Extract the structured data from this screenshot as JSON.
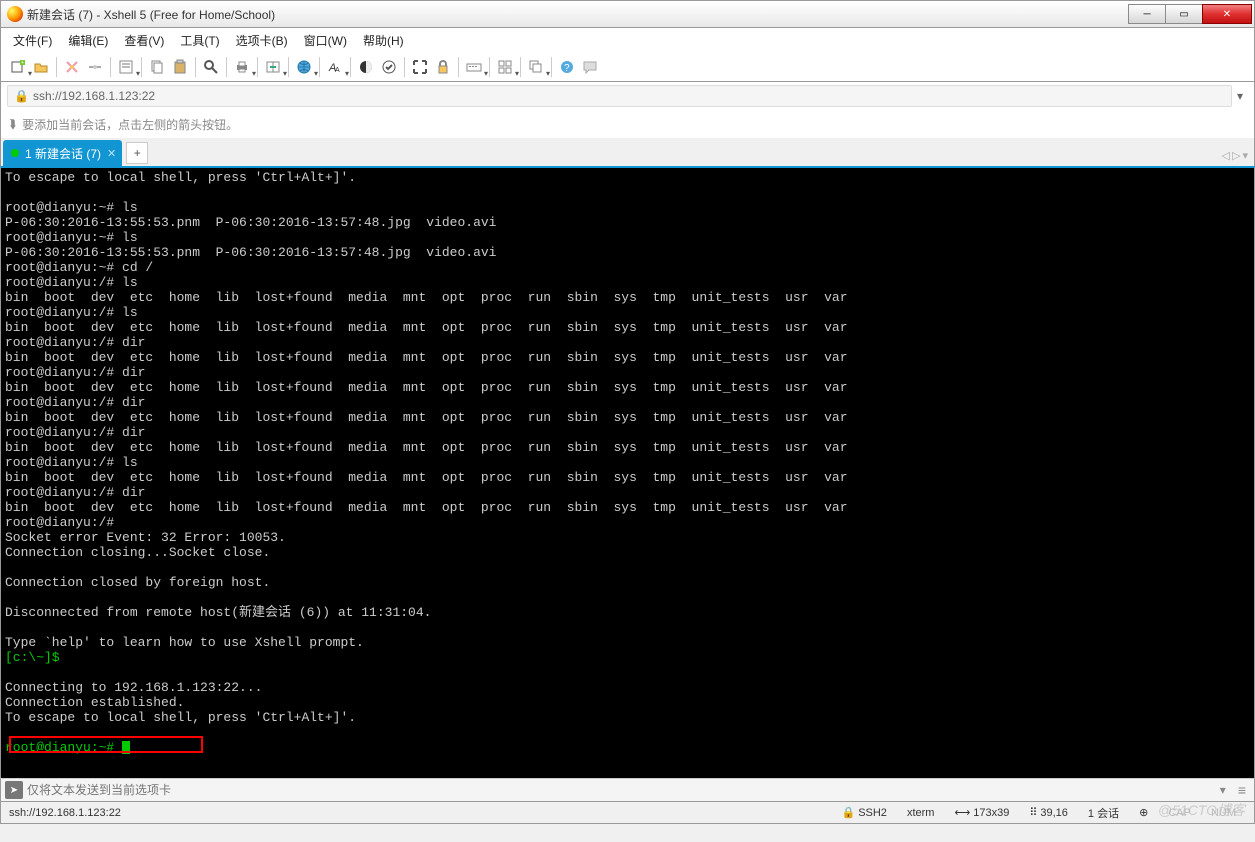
{
  "window": {
    "title": "新建会话 (7) - Xshell 5 (Free for Home/School)"
  },
  "menu": {
    "file": "文件(F)",
    "edit": "编辑(E)",
    "view": "查看(V)",
    "tools": "工具(T)",
    "tabs": "选项卡(B)",
    "window": "窗口(W)",
    "help": "帮助(H)"
  },
  "address": {
    "url": "ssh://192.168.1.123:22"
  },
  "hint": {
    "text": "要添加当前会话，点击左侧的箭头按钮。"
  },
  "tab": {
    "label": "1 新建会话 (7)",
    "add": "+"
  },
  "terminal": {
    "lines": [
      {
        "t": "To escape to local shell, press 'Ctrl+Alt+]'.",
        "c": ""
      },
      {
        "t": "",
        "c": ""
      },
      {
        "t": "root@dianyu:~# ls",
        "c": ""
      },
      {
        "t": "P-06:30:2016-13:55:53.pnm  P-06:30:2016-13:57:48.jpg  video.avi",
        "c": ""
      },
      {
        "t": "root@dianyu:~# ls",
        "c": ""
      },
      {
        "t": "P-06:30:2016-13:55:53.pnm  P-06:30:2016-13:57:48.jpg  video.avi",
        "c": ""
      },
      {
        "t": "root@dianyu:~# cd /",
        "c": ""
      },
      {
        "t": "root@dianyu:/# ls",
        "c": ""
      },
      {
        "t": "bin  boot  dev  etc  home  lib  lost+found  media  mnt  opt  proc  run  sbin  sys  tmp  unit_tests  usr  var",
        "c": ""
      },
      {
        "t": "root@dianyu:/# ls",
        "c": ""
      },
      {
        "t": "bin  boot  dev  etc  home  lib  lost+found  media  mnt  opt  proc  run  sbin  sys  tmp  unit_tests  usr  var",
        "c": ""
      },
      {
        "t": "root@dianyu:/# dir",
        "c": ""
      },
      {
        "t": "bin  boot  dev  etc  home  lib  lost+found  media  mnt  opt  proc  run  sbin  sys  tmp  unit_tests  usr  var",
        "c": ""
      },
      {
        "t": "root@dianyu:/# dir",
        "c": ""
      },
      {
        "t": "bin  boot  dev  etc  home  lib  lost+found  media  mnt  opt  proc  run  sbin  sys  tmp  unit_tests  usr  var",
        "c": ""
      },
      {
        "t": "root@dianyu:/# dir",
        "c": ""
      },
      {
        "t": "bin  boot  dev  etc  home  lib  lost+found  media  mnt  opt  proc  run  sbin  sys  tmp  unit_tests  usr  var",
        "c": ""
      },
      {
        "t": "root@dianyu:/# dir",
        "c": ""
      },
      {
        "t": "bin  boot  dev  etc  home  lib  lost+found  media  mnt  opt  proc  run  sbin  sys  tmp  unit_tests  usr  var",
        "c": ""
      },
      {
        "t": "root@dianyu:/# ls",
        "c": ""
      },
      {
        "t": "bin  boot  dev  etc  home  lib  lost+found  media  mnt  opt  proc  run  sbin  sys  tmp  unit_tests  usr  var",
        "c": ""
      },
      {
        "t": "root@dianyu:/# dir",
        "c": ""
      },
      {
        "t": "bin  boot  dev  etc  home  lib  lost+found  media  mnt  opt  proc  run  sbin  sys  tmp  unit_tests  usr  var",
        "c": ""
      },
      {
        "t": "root@dianyu:/#",
        "c": ""
      },
      {
        "t": "Socket error Event: 32 Error: 10053.",
        "c": ""
      },
      {
        "t": "Connection closing...Socket close.",
        "c": ""
      },
      {
        "t": "",
        "c": ""
      },
      {
        "t": "Connection closed by foreign host.",
        "c": ""
      },
      {
        "t": "",
        "c": ""
      },
      {
        "t": "Disconnected from remote host(新建会话 (6)) at 11:31:04.",
        "c": ""
      },
      {
        "t": "",
        "c": ""
      },
      {
        "t": "Type `help' to learn how to use Xshell prompt.",
        "c": ""
      },
      {
        "t": "[c:\\~]$",
        "c": "g"
      },
      {
        "t": "",
        "c": ""
      },
      {
        "t": "Connecting to 192.168.1.123:22...",
        "c": ""
      },
      {
        "t": "Connection established.",
        "c": ""
      },
      {
        "t": "To escape to local shell, press 'Ctrl+Alt+]'.",
        "c": ""
      },
      {
        "t": "",
        "c": ""
      }
    ],
    "prompt": "root@dianyu:~# "
  },
  "inputbar": {
    "placeholder": "仅将文本发送到当前选项卡"
  },
  "status": {
    "left": "ssh://192.168.1.123:22",
    "proto": "SSH2",
    "term": "xterm",
    "size": "173x39",
    "pos": "39,16",
    "sess": "1 会话",
    "cap": "CAP",
    "num": "NUM"
  },
  "watermark": "@51CTO博客",
  "icons": {
    "lock": "🔒",
    "hint": "⮯"
  }
}
